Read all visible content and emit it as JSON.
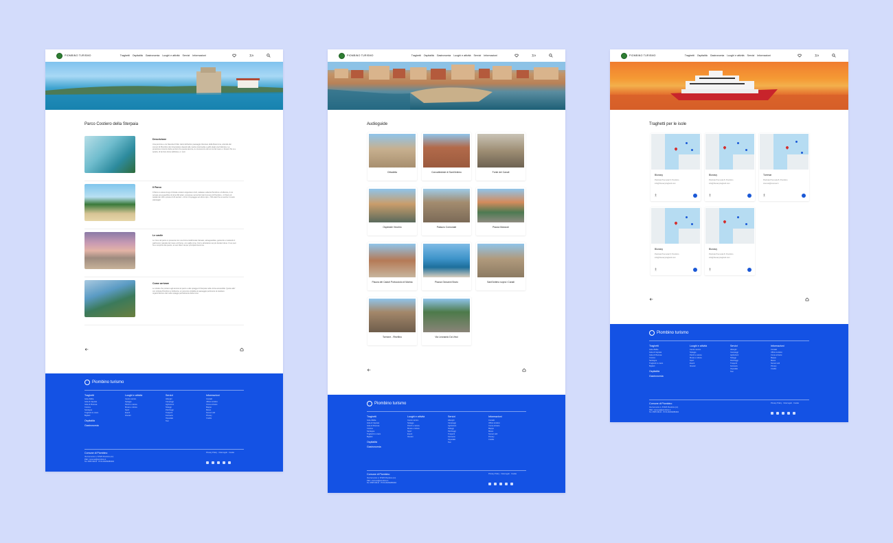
{
  "header": {
    "logo_text": "PIOMBINO TURISMO",
    "nav": [
      "Traghetti",
      "Ospitalità",
      "Gastronomia",
      "Luoghi e attività",
      "Servizi",
      "Informazioni"
    ]
  },
  "page1": {
    "title": "Parco Costiero della Sterpaia",
    "rows": [
      {
        "title": "Descrizione",
        "text": "Una pennica e ore Navetta di Mar, darsi dell'antico paesaggio litoraneo della Maremma, azienda dai comuni di Piombino dei intracostiere davanti alle marine intermedia e golfo degli una Follonica. La protezione incontro delle porzioni fra questa laconia, le conoscenze dei con la del mare e i litorali. Più si a spiaria, di la dune duna sabbiosa, e i suoi."
      },
      {
        "title": "Il Parco",
        "text": "Il Parco è esteso lungo il litorale costiero Argentiero Andi, cadasse sulla da Piombino a Follonica, il cui occupa una superficie di circa 294 ettari, comprese nei territori dei Comune di Piombino. • Il Parco di tutelati dei 100 e pinete di 20 sentieri • 13 km di spiaggie sul ultimo tipo • 700 ettari fra cui anche il nostro paesaggio"
      },
      {
        "title": "Le cavile",
        "text": "Le zone del parco si presenta con una forma tradizionale l'attuale, salvaguardata, gestendo e tutelando il patrimonio naturale del mare a di fiume, con salde zone. Fiori e altrettanto sui più duraturi dune. Il tuo puoi fra e scoprirlo del questo, ai suoi rilievi via per principali insomma."
      },
      {
        "title": "Come arrivare",
        "text": "Le strade che portano agli accessi al parco e alle spiagge di Sterpaia nella vicina accessibile \"grazie alla\" con ciclopia Piombino a Follonica, un percorso ciclabile al paesaggio pertinente al carattere organizzazione dal molte spiagge parzialmente della zona."
      }
    ]
  },
  "page2": {
    "title": "Audioguide",
    "cards": [
      "Cittadella",
      "Concattedrale di Sant'Antimo",
      "Fonte dei Canali",
      "Ospedale Vecchio",
      "Palazzo Comunale",
      "Piazza Manzoni",
      "Piazza dei Caduti Portocciolo di Marina",
      "Piazza Giovanni Bovio",
      "Sant'Antimo sopra i Canali",
      "Torrione - Rivellino",
      "Via Leonardo Da Vinci"
    ]
  },
  "page3": {
    "title": "Traghetti per le isole",
    "cards": [
      {
        "name": "Blunavy",
        "addr": "Piazzale Premuda 8, Piombino",
        "mail": "info@blunavytraghetti.com"
      },
      {
        "name": "Blunavy",
        "addr": "Piazzale Premuda 8, Piombino",
        "mail": "info@blunavytraghetti.com"
      },
      {
        "name": "Toremar",
        "addr": "Piazzale Premuda 8, Piombino",
        "mail": "toremar@toremar.it"
      },
      {
        "name": "Blunavy",
        "addr": "Piazzale Premuda 8, Piombino",
        "mail": "info@blunavytraghetti.com"
      },
      {
        "name": "Blunavy",
        "addr": "Piazzale Premuda 8, Piombino",
        "mail": "info@blunavytraghetti.com"
      }
    ]
  },
  "footer": {
    "brand": "Piombino turismo",
    "cols": [
      {
        "title": "Traghetti",
        "items": [
          "Isola d'Elba",
          "Isola di Capraia",
          "Isola di Pianosa",
          "Corsica",
          "Sardegna",
          "Traghetti in orario",
          "Biglietti"
        ],
        "extra": [
          "Ospitalità",
          "Gastronomia"
        ]
      },
      {
        "title": "Luoghi e attività",
        "items": [
          "Centro storico",
          "Spiagge",
          "Parchi e natura",
          "Musei e cultura",
          "Sport",
          "Eventi",
          "Itinerari"
        ],
        "extra": []
      },
      {
        "title": "Servizi",
        "items": [
          "Alberghi",
          "Campeggi",
          "Agriturismi",
          "Noleggi",
          "Parcheggi",
          "Trasporti",
          "Farmacie",
          "Ospedale",
          "Taxi"
        ],
        "extra": []
      },
      {
        "title": "Informazioni",
        "items": [
          "Contatti",
          "Ufficio turistico",
          "Come arrivare",
          "Mappe",
          "Meteo",
          "Numeri utili",
          "Privacy",
          "Credits"
        ],
        "extra": []
      }
    ],
    "comune": "Comune di Piombino",
    "contact_lines": [
      "Via Ferruccio 4, 57025 Piombino (LI)",
      "PEC: comune@piombino.it",
      "Tel. 0565 63111 · P.IVA 00290280494"
    ],
    "legal": [
      "Privacy Policy",
      "Note legali",
      "Cookie"
    ]
  },
  "colors": {
    "background": "#d3dcfb",
    "brand_blue": "#1452e4",
    "accent_blue": "#1a58d6"
  }
}
